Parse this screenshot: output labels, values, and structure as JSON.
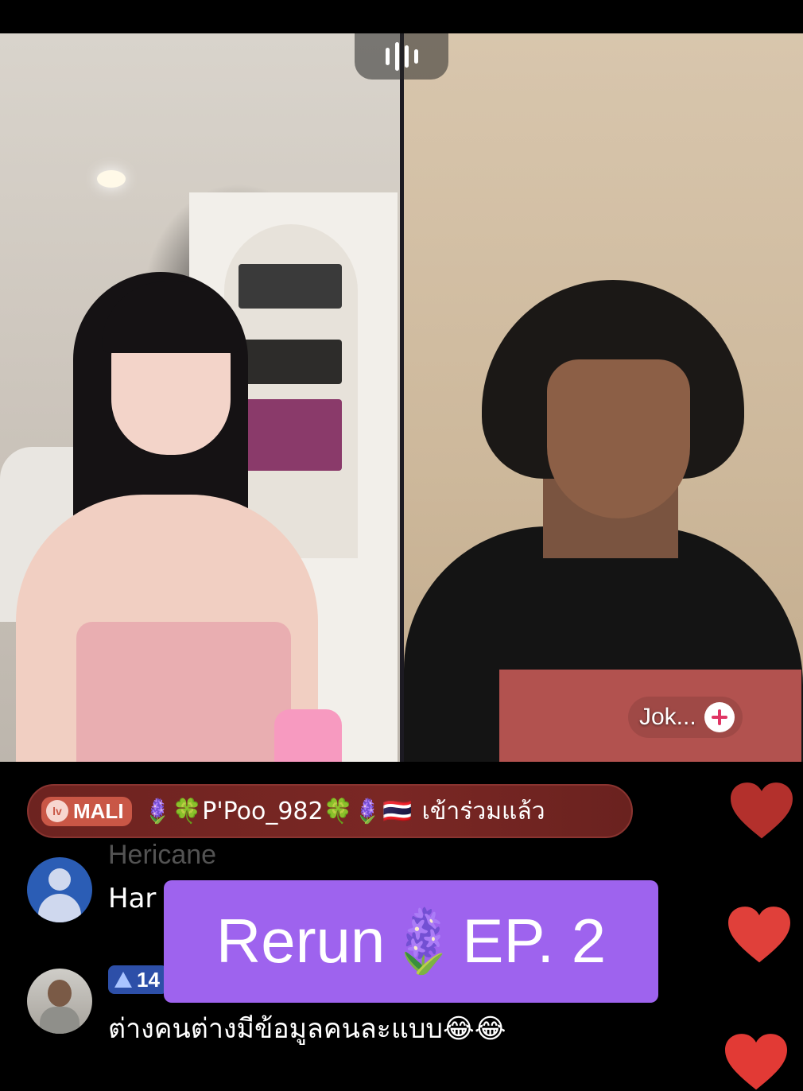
{
  "stream": {
    "guest_name": "Jok...",
    "follow_symbol": "+"
  },
  "join_banner": {
    "level_icon_text": "lv",
    "level_label": "MALI",
    "username": "🪻🍀P'Poo_982🍀🪻🇹🇭",
    "message": "เข้าร่วมแล้ว",
    "background_color": "#6d2320"
  },
  "comments": [
    {
      "username": "Hericane",
      "text": "Har",
      "avatar": "default-avatar-icon"
    },
    {
      "rank": "14",
      "text": "ต่างคนต่างมีข้อมูลคนละแบบ😂😂",
      "avatar": "user-photo-avatar"
    }
  ],
  "overlay": {
    "title": "Rerun🪻EP. 2",
    "background_color": "#9e63ee"
  },
  "reactions": {
    "heart_colors": [
      "#b3302c",
      "#e0403a",
      "#e23a35"
    ]
  },
  "icons": {
    "audio": "audio-bars-icon",
    "follow": "plus-icon",
    "like": "heart-icon",
    "rank": "rank-triangle-icon"
  }
}
